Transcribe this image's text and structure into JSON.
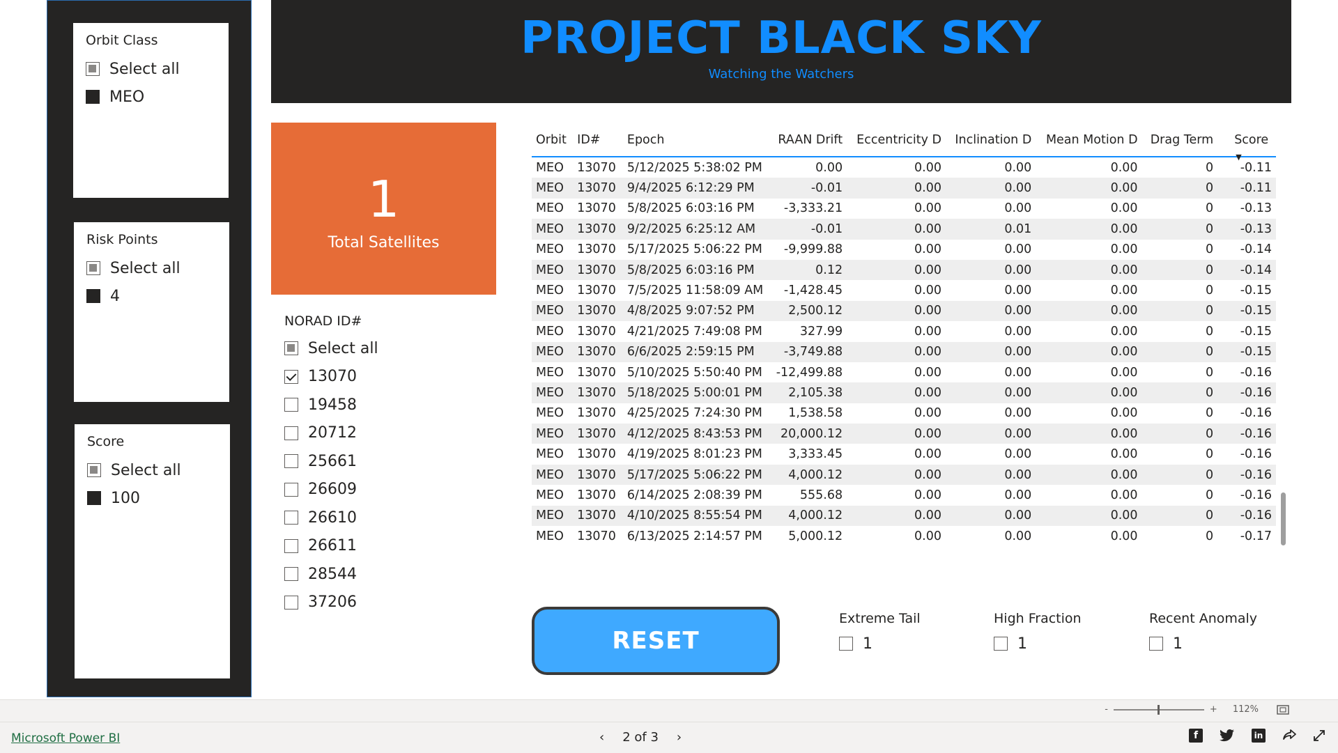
{
  "header": {
    "title": "PROJECT BLACK SKY",
    "subtitle": "Watching the Watchers"
  },
  "filters": {
    "orbit_class": {
      "title": "Orbit Class",
      "select_all": "Select all",
      "items": [
        "MEO"
      ]
    },
    "risk_points": {
      "title": "Risk Points",
      "select_all": "Select all",
      "items": [
        "4"
      ]
    },
    "score": {
      "title": "Score",
      "select_all": "Select all",
      "items": [
        "100"
      ]
    }
  },
  "card": {
    "value": "1",
    "label": "Total Satellites",
    "color": "#e66c37"
  },
  "norad": {
    "title": "NORAD ID#",
    "select_all": "Select all",
    "items": [
      {
        "id": "13070",
        "checked": true
      },
      {
        "id": "19458",
        "checked": false
      },
      {
        "id": "20712",
        "checked": false
      },
      {
        "id": "25661",
        "checked": false
      },
      {
        "id": "26609",
        "checked": false
      },
      {
        "id": "26610",
        "checked": false
      },
      {
        "id": "26611",
        "checked": false
      },
      {
        "id": "28544",
        "checked": false
      },
      {
        "id": "37206",
        "checked": false
      }
    ]
  },
  "table": {
    "columns": [
      "Orbit",
      "ID#",
      "Epoch",
      "RAAN Drift",
      "Eccentricity D",
      "Inclination D",
      "Mean Motion D",
      "Drag Term",
      "Score"
    ],
    "sorted_by": "Score",
    "rows": [
      [
        "MEO",
        "13070",
        "5/12/2025 5:38:02 PM",
        "0.00",
        "0.00",
        "0.00",
        "0.00",
        "0",
        "-0.11"
      ],
      [
        "MEO",
        "13070",
        "9/4/2025 6:12:29 PM",
        "-0.01",
        "0.00",
        "0.00",
        "0.00",
        "0",
        "-0.11"
      ],
      [
        "MEO",
        "13070",
        "5/8/2025 6:03:16 PM",
        "-3,333.21",
        "0.00",
        "0.00",
        "0.00",
        "0",
        "-0.13"
      ],
      [
        "MEO",
        "13070",
        "9/2/2025 6:25:12 AM",
        "-0.01",
        "0.00",
        "0.01",
        "0.00",
        "0",
        "-0.13"
      ],
      [
        "MEO",
        "13070",
        "5/17/2025 5:06:22 PM",
        "-9,999.88",
        "0.00",
        "0.00",
        "0.00",
        "0",
        "-0.14"
      ],
      [
        "MEO",
        "13070",
        "5/8/2025 6:03:16 PM",
        "0.12",
        "0.00",
        "0.00",
        "0.00",
        "0",
        "-0.14"
      ],
      [
        "MEO",
        "13070",
        "7/5/2025 11:58:09 AM",
        "-1,428.45",
        "0.00",
        "0.00",
        "0.00",
        "0",
        "-0.15"
      ],
      [
        "MEO",
        "13070",
        "4/8/2025 9:07:52 PM",
        "2,500.12",
        "0.00",
        "0.00",
        "0.00",
        "0",
        "-0.15"
      ],
      [
        "MEO",
        "13070",
        "4/21/2025 7:49:08 PM",
        "327.99",
        "0.00",
        "0.00",
        "0.00",
        "0",
        "-0.15"
      ],
      [
        "MEO",
        "13070",
        "6/6/2025 2:59:15 PM",
        "-3,749.88",
        "0.00",
        "0.00",
        "0.00",
        "0",
        "-0.15"
      ],
      [
        "MEO",
        "13070",
        "5/10/2025 5:50:40 PM",
        "-12,499.88",
        "0.00",
        "0.00",
        "0.00",
        "0",
        "-0.16"
      ],
      [
        "MEO",
        "13070",
        "5/18/2025 5:00:01 PM",
        "2,105.38",
        "0.00",
        "0.00",
        "0.00",
        "0",
        "-0.16"
      ],
      [
        "MEO",
        "13070",
        "4/25/2025 7:24:30 PM",
        "1,538.58",
        "0.00",
        "0.00",
        "0.00",
        "0",
        "-0.16"
      ],
      [
        "MEO",
        "13070",
        "4/12/2025 8:43:53 PM",
        "20,000.12",
        "0.00",
        "0.00",
        "0.00",
        "0",
        "-0.16"
      ],
      [
        "MEO",
        "13070",
        "4/19/2025 8:01:23 PM",
        "3,333.45",
        "0.00",
        "0.00",
        "0.00",
        "0",
        "-0.16"
      ],
      [
        "MEO",
        "13070",
        "5/17/2025 5:06:22 PM",
        "4,000.12",
        "0.00",
        "0.00",
        "0.00",
        "0",
        "-0.16"
      ],
      [
        "MEO",
        "13070",
        "6/14/2025 2:08:39 PM",
        "555.68",
        "0.00",
        "0.00",
        "0.00",
        "0",
        "-0.16"
      ],
      [
        "MEO",
        "13070",
        "4/10/2025 8:55:54 PM",
        "4,000.12",
        "0.00",
        "0.00",
        "0.00",
        "0",
        "-0.16"
      ],
      [
        "MEO",
        "13070",
        "6/13/2025 2:14:57 PM",
        "5,000.12",
        "0.00",
        "0.00",
        "0.00",
        "0",
        "-0.17"
      ]
    ]
  },
  "reset": {
    "label": "RESET",
    "color": "#3fa9ff"
  },
  "flags": [
    {
      "title": "Extreme Tail",
      "value": "1"
    },
    {
      "title": "High Fraction",
      "value": "1"
    },
    {
      "title": "Recent Anomaly",
      "value": "1"
    }
  ],
  "footer": {
    "brand_link": "Microsoft Power BI",
    "page_indicator": "2 of 3",
    "zoom_minus": "-",
    "zoom_plus": "+",
    "zoom_level": "112%"
  },
  "colors": {
    "accent": "#118dff",
    "dark_panel": "#252423"
  },
  "icons": [
    "chevron-left-icon",
    "chevron-right-icon",
    "fit-page-icon",
    "facebook-icon",
    "twitter-icon",
    "linkedin-icon",
    "share-icon",
    "fullscreen-icon"
  ]
}
